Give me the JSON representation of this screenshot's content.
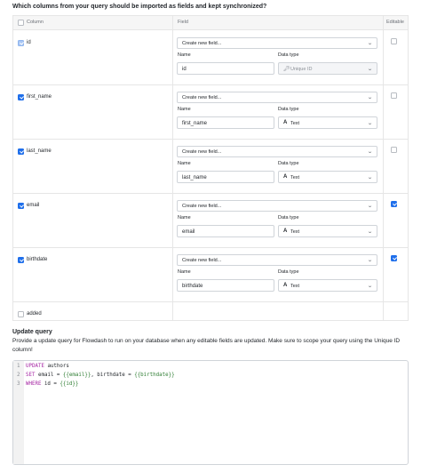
{
  "heading": "Which columns from your query should be imported as fields and kept synchronized?",
  "table": {
    "headers": {
      "column": "Column",
      "field": "Field",
      "editable": "Editable"
    },
    "rows": [
      {
        "name": "id",
        "checked": "dim",
        "editable": false,
        "field_select": "Create new field...",
        "name_label": "Name",
        "name_value": "id",
        "type_label": "Data type",
        "type_value": "Unique ID",
        "type_icon": "key-icon",
        "type_disabled": true
      },
      {
        "name": "first_name",
        "checked": "on",
        "editable": false,
        "field_select": "Create new field...",
        "name_label": "Name",
        "name_value": "first_name",
        "type_label": "Data type",
        "type_value": "Text",
        "type_icon": "text-type-icon",
        "type_disabled": false
      },
      {
        "name": "last_name",
        "checked": "on",
        "editable": false,
        "field_select": "Create new field...",
        "name_label": "Name",
        "name_value": "last_name",
        "type_label": "Data type",
        "type_value": "Text",
        "type_icon": "text-type-icon",
        "type_disabled": false
      },
      {
        "name": "email",
        "checked": "on",
        "editable": true,
        "field_select": "Create new field...",
        "name_label": "Name",
        "name_value": "email",
        "type_label": "Data type",
        "type_value": "Text",
        "type_icon": "text-type-icon",
        "type_disabled": false
      },
      {
        "name": "birthdate",
        "checked": "on",
        "editable": true,
        "field_select": "Create new field...",
        "name_label": "Name",
        "name_value": "birthdate",
        "type_label": "Data type",
        "type_value": "Text",
        "type_icon": "text-type-icon",
        "type_disabled": false
      },
      {
        "name": "added",
        "checked": "off",
        "editable": null
      }
    ]
  },
  "update_query": {
    "title": "Update query",
    "description": "Provide a update query for Flowdash to run on your database when any editable fields are updated. Make sure to scope your query using the Unique ID column!",
    "lines": [
      {
        "num": "1",
        "kw": "UPDATE",
        "rest": " authors",
        "tpl": "",
        "tail": ""
      },
      {
        "num": "2",
        "kw": "SET",
        "rest": " email = ",
        "tpl": "{{email}}",
        "tail": ", birthdate = ",
        "tpl2": "{{birthdate}}"
      },
      {
        "num": "3",
        "kw": "WHERE",
        "rest": " id = ",
        "tpl": "{{id}}",
        "tail": ""
      }
    ]
  },
  "colors": {
    "accent": "#1f6feb",
    "keyword": "#a626a4",
    "template": "#2e7d32"
  }
}
